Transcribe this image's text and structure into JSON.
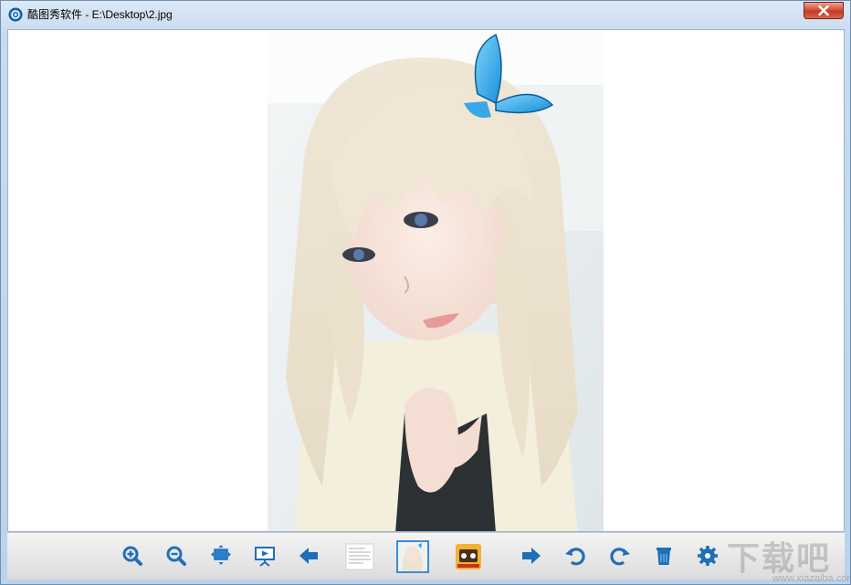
{
  "window": {
    "title": "酷图秀软件 - E:\\Desktop\\2.jpg",
    "app_icon": "app-logo-icon"
  },
  "title_bar": {
    "close_icon": "close-icon"
  },
  "viewer": {
    "image_description_icon": "photo"
  },
  "toolbar": {
    "tools": [
      {
        "name": "zoom-in-button",
        "icon": "zoom-in-icon"
      },
      {
        "name": "zoom-out-button",
        "icon": "zoom-out-icon"
      },
      {
        "name": "fit-window-button",
        "icon": "fit-window-icon"
      },
      {
        "name": "slideshow-button",
        "icon": "slideshow-icon"
      },
      {
        "name": "previous-button",
        "icon": "arrow-left-icon"
      },
      {
        "name": "next-button",
        "icon": "arrow-right-icon"
      },
      {
        "name": "rotate-left-button",
        "icon": "rotate-left-icon"
      },
      {
        "name": "rotate-right-button",
        "icon": "rotate-right-icon"
      },
      {
        "name": "delete-button",
        "icon": "trash-icon"
      },
      {
        "name": "settings-button",
        "icon": "gear-icon"
      }
    ],
    "thumbnails": [
      {
        "name": "thumbnail-document"
      },
      {
        "name": "thumbnail-current-photo",
        "active": true
      },
      {
        "name": "thumbnail-game-art"
      }
    ]
  },
  "watermark": {
    "text": "下载吧",
    "subtext": "www.xiazaiba.com"
  },
  "colors": {
    "icon_blue": "#1f6fb8",
    "titlebar": "#c9dcef",
    "close_red": "#c43b25",
    "toolbar": "#e6e6e6"
  }
}
